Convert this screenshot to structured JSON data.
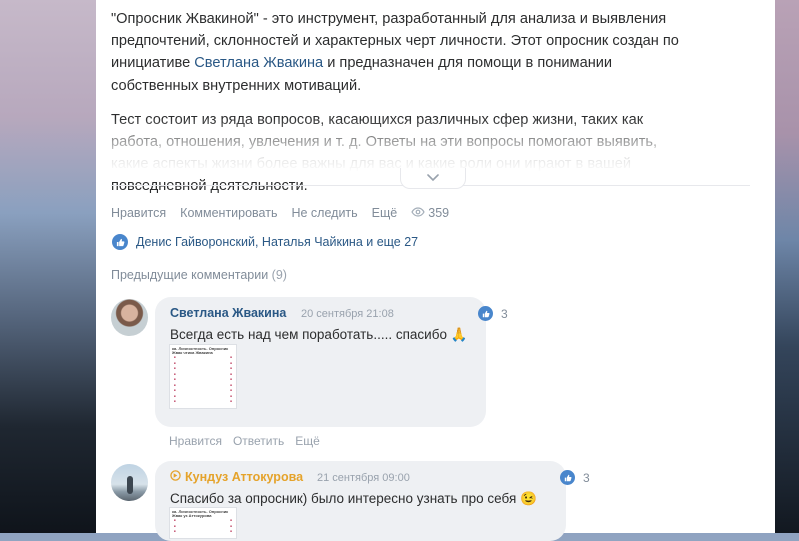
{
  "post": {
    "paragraph1": {
      "before": "\"Опросник Жвакиной\" - это инструмент, разработанный для анализа и выявления предпочтений, склонностей и характерных черт личности. Этот опросник создан по инициативе ",
      "link": "Светлана Жвакина",
      "after": " и предназначен для помощи в понимании собственных внутренних мотиваций."
    },
    "paragraph2": "Тест состоит из ряда вопросов, касающихся различных сфер жизни, таких как работа, отношения, увлечения и т. д. Ответы на эти вопросы помогают выявить, какие аспекты жизни более важны для вас и какие роли они играют в вашей повседневной деятельности."
  },
  "actions": {
    "like": "Нравится",
    "comment": "Комментировать",
    "unfollow": "Не следить",
    "more": "Ещё",
    "views": "359"
  },
  "likers": "Денис Гайворонский, Наталья Чайкина и еще 27",
  "previous_comments": {
    "label": "Предыдущие комментарии",
    "count": "(9)"
  },
  "comments": [
    {
      "author": "Светлана Жвакина",
      "date": "20 сентября 21:08",
      "text": "Всегда есть над чем поработать..... спасибо",
      "emoji": "🙏",
      "likes": "3",
      "author_color": "#2a5885",
      "thumb_title": "ка. Личностность. Опросник Жвак чтика Жвакина",
      "actions": {
        "like": "Нравится",
        "reply": "Ответить",
        "more": "Ещё"
      }
    },
    {
      "author": "Кундуз Аттокурова",
      "date": "21 сентября 09:00",
      "text": "Спасибо за опросник) было интересно узнать про себя",
      "emoji": "😉",
      "likes": "3",
      "author_color": "#e5a32b",
      "thumb_title": "ка. Личностность. Опросник Жвак уз Аттокурова"
    }
  ],
  "colors": {
    "link": "#2a5885",
    "like_blue": "#4986cc",
    "muted": "#818c99"
  },
  "icons": [
    "chevron-down-icon",
    "eye-icon",
    "like-icon",
    "donut-badge-icon"
  ]
}
